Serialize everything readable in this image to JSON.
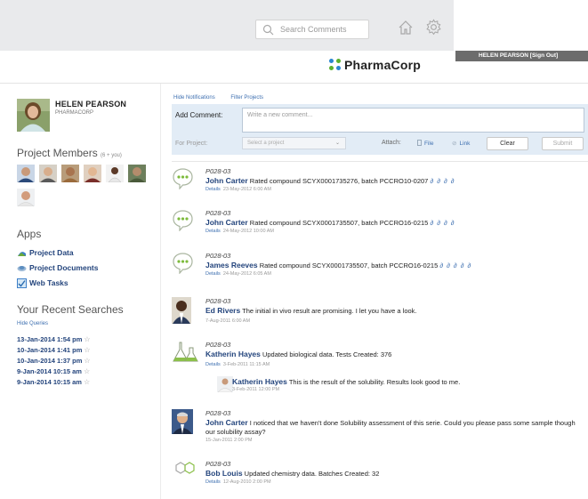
{
  "topbar": {
    "search_placeholder": "Search Comments"
  },
  "user": {
    "name": "HELEN PEARSON",
    "signout": "[Sign Out]",
    "org": "PHARMACORP"
  },
  "brand": {
    "name": "PharmaCorp",
    "dot_colors": [
      "#2a87d0",
      "#5bb12f",
      "#2a87d0",
      "#5bb12f"
    ]
  },
  "members": {
    "title": "Project Members",
    "count": "(6 + you)",
    "items": [
      {
        "name": "member-1",
        "skin": "#c99a7a",
        "shirt": "#2c4a7a"
      },
      {
        "name": "member-2",
        "skin": "#d8ae8c",
        "shirt": "#5a5a5a"
      },
      {
        "name": "member-3",
        "skin": "#a8744f",
        "shirt": "#9b6b3c"
      },
      {
        "name": "member-4",
        "skin": "#e2b793",
        "shirt": "#7a2f2a"
      },
      {
        "name": "member-5",
        "skin": "#5c3a28",
        "shirt": "#e8e8e8"
      },
      {
        "name": "member-6",
        "skin": "#7a8f6a",
        "shirt": "#4a5a3a"
      },
      {
        "name": "member-7",
        "skin": "#d29c7c",
        "shirt": "#e8e8e8"
      }
    ]
  },
  "apps": {
    "title": "Apps",
    "items": [
      {
        "label": "Project Data",
        "icon": "data-icon"
      },
      {
        "label": "Project Documents",
        "icon": "documents-icon"
      },
      {
        "label": "Web Tasks",
        "icon": "tasks-icon"
      }
    ]
  },
  "recent_searches": {
    "title": "Your Recent Searches",
    "hide_label": "Hide Queries",
    "items": [
      "13-Jan-2014 1:54 pm",
      "10-Jan-2014 1:41 pm",
      "10-Jan-2014 1:37 pm",
      "9-Jan-2014 10:15 am",
      "9-Jan-2014 10:15 am"
    ]
  },
  "links": {
    "hide_notifications": "Hide Notifications",
    "filter_projects": "Filter Projects"
  },
  "add_comment": {
    "label": "Add Comment:",
    "placeholder": "Write a new comment...",
    "for_project_label": "For Project:",
    "project_placeholder": "Select a project",
    "attach_label": "Attach:",
    "file_label": "File",
    "link_label": "Link",
    "clear_label": "Clear",
    "submit_label": "Submit"
  },
  "feed": [
    {
      "project": "P028-03",
      "author": "John Carter",
      "text": " Rated compound SCYX0001735276, batch PCCRO10-0207 ",
      "rating": "∂ ∂ ∂ ∂",
      "details": "Details",
      "date": "23-May-2012 6:00 AM",
      "avatar": "chat-bubble-icon"
    },
    {
      "project": "P028-03",
      "author": "John Carter",
      "text": " Rated compound SCYX0001735507, batch PCCRO16-0215 ",
      "rating": "∂ ∂ ∂ ∂",
      "details": "Details",
      "date": "24-May-2012 10:00 AM",
      "avatar": "chat-bubble-icon"
    },
    {
      "project": "P028-03",
      "author": "James Reeves",
      "text": " Rated compound SCYX0001735507, batch PCCRO16-0215 ",
      "rating": "∂ ∂ ∂ ∂ ∂",
      "details": "Details",
      "date": "24-May-2012 6:05 AM",
      "avatar": "chat-bubble-icon"
    },
    {
      "project": "P028-03",
      "author": "Ed Rivers",
      "text": " The initial in vivo result are promising. I let you have a look.",
      "details": "",
      "date": "7-Aug-2011 6:00 AM",
      "avatar": "person-photo"
    },
    {
      "project": "P028-03",
      "author": "Katherin Hayes",
      "text": " Updated biological data. Tests Created: 376",
      "details": "Details",
      "date": "3-Feb-2011 11:15 AM",
      "avatar": "flask-icon"
    },
    {
      "project": "P028-03",
      "author": "John Carter",
      "text": " I noticed that we haven't done Solubility assessment of this serie. Could you please pass some sample though our solubility assay?",
      "details": "",
      "date": "15-Jan-2011 2:00 PM",
      "avatar": "person-photo"
    },
    {
      "project": "P028-03",
      "author": "Bob Louis",
      "text": " Updated chemistry data. Batches Created: 32",
      "details": "Details",
      "date": "12-Aug-2010 2:00 PM",
      "avatar": "molecule-icon"
    }
  ],
  "reply": {
    "author": "Katherin Hayes",
    "text": " This is the result of the solubility. Results look good to me.",
    "date": "3-Feb-2011 12:00 PM"
  }
}
